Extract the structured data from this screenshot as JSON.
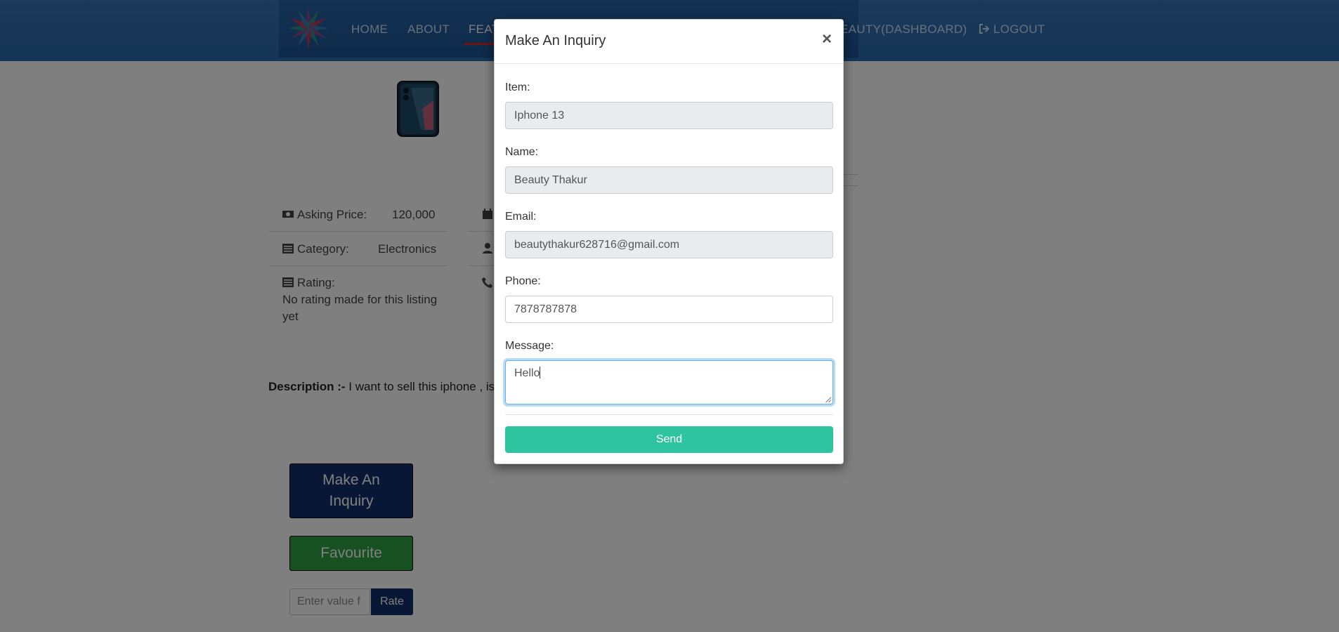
{
  "navbar": {
    "links": {
      "home": "HOME",
      "about": "ABOUT",
      "features": "FEAT",
      "dashboard": "EAUTY(DASHBOARD)",
      "logout": "LOGOUT"
    },
    "brand_color": "#2f70b6",
    "active_underline_color": "#e02424"
  },
  "listing": {
    "asking_price_label": "Asking Price:",
    "asking_price_value": "120,000",
    "category_label": "Category:",
    "category_value": "Electronics",
    "rating_label": "Rating:",
    "rating_value_line1": "No rating made for this listing",
    "rating_value_line2": "yet",
    "description_label": "Description :-",
    "description_text": " I want to sell this iphone , is th",
    "icons": [
      "money-icon",
      "calendar-icon",
      "list-icon",
      "user-icon",
      "list-icon",
      "phone-icon"
    ]
  },
  "actions": {
    "inquiry_line1": "Make An",
    "inquiry_line2": "Inquiry",
    "favourite": "Favourite",
    "rate_placeholder": "Enter value f",
    "rate_button": "Rate"
  },
  "modal": {
    "title": "Make An Inquiry",
    "close": "×",
    "item_label": "Item:",
    "item_value": "Iphone 13",
    "name_label": "Name:",
    "name_value": "Beauty Thakur",
    "email_label": "Email:",
    "email_value": "beautythakur628716@gmail.com",
    "phone_label": "Phone:",
    "phone_value": "7878787878",
    "message_label": "Message:",
    "message_value": "Hello",
    "send_button": "Send",
    "send_color": "#2fc4a0"
  }
}
